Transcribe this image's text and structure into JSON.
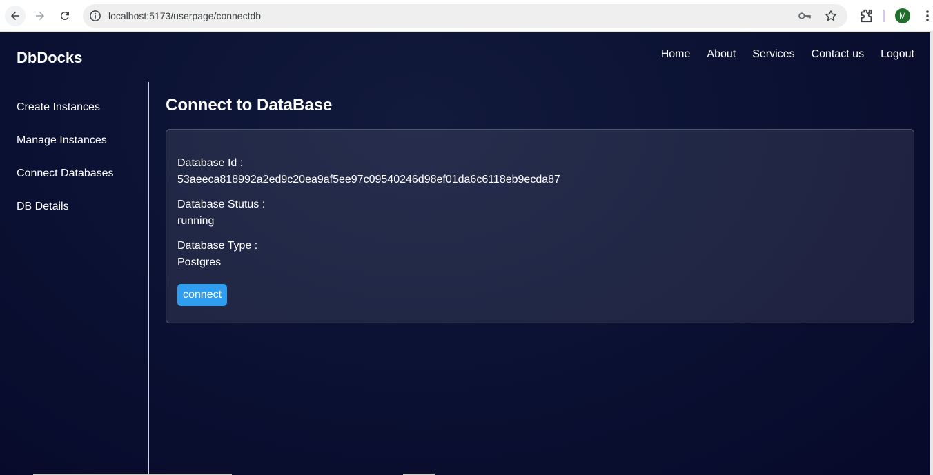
{
  "browser": {
    "url": "localhost:5173/userpage/connectdb",
    "avatar_initial": "M",
    "icons": [
      "back-icon",
      "forward-icon",
      "reload-icon",
      "info-icon",
      "key-icon",
      "star-icon",
      "extensions-icon",
      "kebab-menu-icon"
    ]
  },
  "header": {
    "brand": "DbDocks",
    "nav": [
      "Home",
      "About",
      "Services",
      "Contact us",
      "Logout"
    ]
  },
  "sidebar": {
    "items": [
      "Create Instances",
      "Manage Instances",
      "Connect Databases",
      "DB Details"
    ]
  },
  "main": {
    "title": "Connect to DataBase",
    "fields": [
      {
        "label": "Database Id :",
        "value": "53aeeca818992a2ed9c20ea9af5ee97c09540246d98ef01da6c6118eb9ecda87"
      },
      {
        "label": "Database Stutus :",
        "value": "running"
      },
      {
        "label": "Database Type :",
        "value": "Postgres"
      }
    ],
    "connect_label": "connect"
  },
  "colors": {
    "background": "#0b1233",
    "button": "#2f9df0",
    "text": "#ffffff"
  }
}
